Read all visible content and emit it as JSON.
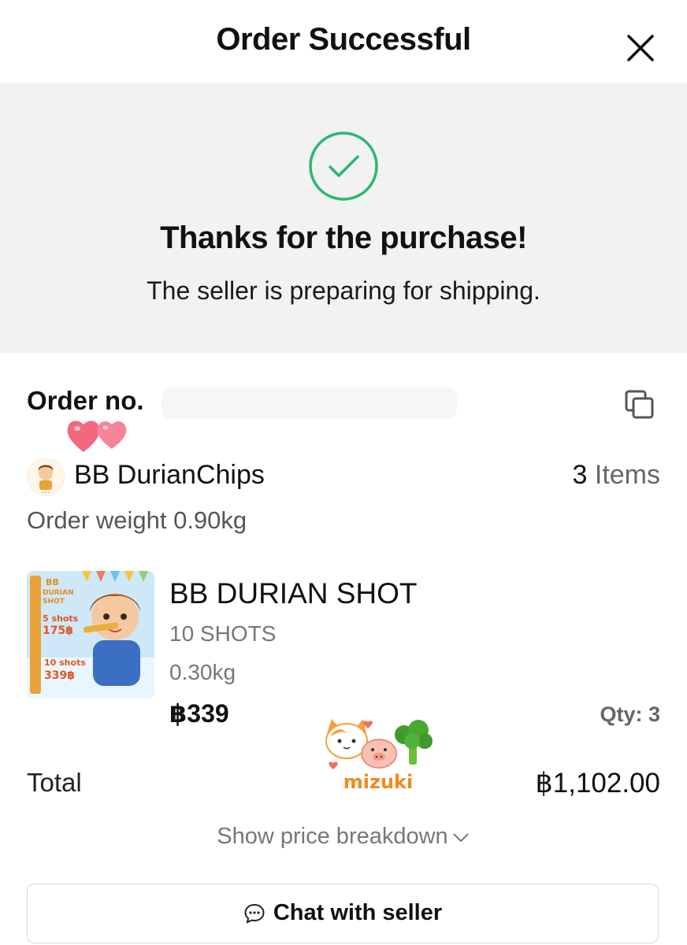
{
  "header": {
    "title": "Order Successful",
    "close_icon": "close-icon"
  },
  "hero": {
    "icon": "check-circle-icon",
    "accent_color": "#2bb673",
    "title": "Thanks for the purchase!",
    "subtitle": "The seller is preparing for shipping."
  },
  "order": {
    "label": "Order no.",
    "copy_icon": "copy-icon"
  },
  "shop": {
    "name": "BB DurianChips",
    "items_count": "3",
    "items_label": "Items",
    "order_weight": "Order weight 0.90kg"
  },
  "product": {
    "name": "BB DURIAN SHOT",
    "variant": "10 SHOTS",
    "weight": "0.30kg",
    "price": "฿339",
    "qty": "Qty: 3",
    "thumb_text": {
      "brand_line1": "BB",
      "brand_line2": "DURIAN",
      "brand_line3": "SHOT",
      "offer1_qty": "5 shots",
      "offer1_price": "175฿",
      "offer2_qty": "10 shots",
      "offer2_price": "339฿"
    }
  },
  "watermark": {
    "text": "mizuki"
  },
  "summary": {
    "total_label": "Total",
    "total_value": "฿1,102.00",
    "breakdown_label": "Show price breakdown"
  },
  "actions": {
    "chat_label": "Chat with seller",
    "chat_icon": "chat-bubble-icon"
  }
}
